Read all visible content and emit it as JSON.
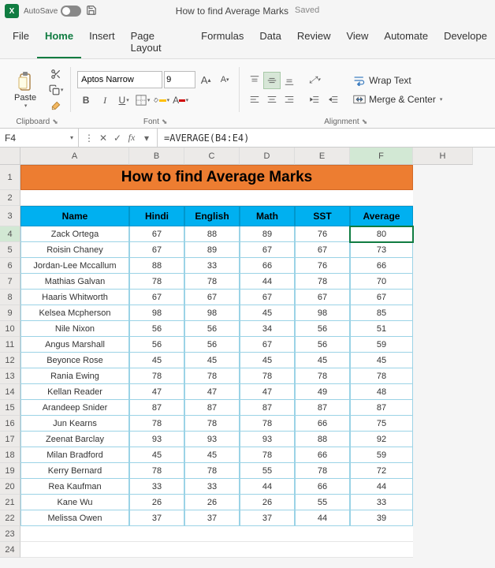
{
  "titlebar": {
    "autosave_label": "AutoSave",
    "doc_name": "How to find Average Marks",
    "saved_status": "Saved"
  },
  "menubar": {
    "tabs": [
      "File",
      "Home",
      "Insert",
      "Page Layout",
      "Formulas",
      "Data",
      "Review",
      "View",
      "Automate",
      "Develope"
    ]
  },
  "ribbon": {
    "clipboard": {
      "paste": "Paste",
      "group": "Clipboard"
    },
    "font": {
      "name": "Aptos Narrow",
      "size": "9",
      "group": "Font"
    },
    "alignment": {
      "wrap": "Wrap Text",
      "merge": "Merge & Center",
      "group": "Alignment"
    }
  },
  "formula": {
    "namebox": "F4",
    "bar": "=AVERAGE(B4:E4)"
  },
  "columns": [
    "A",
    "B",
    "C",
    "D",
    "E",
    "F",
    "H"
  ],
  "rows": [
    "1",
    "2",
    "3",
    "4",
    "5",
    "6",
    "7",
    "8",
    "9",
    "10",
    "11",
    "12",
    "13",
    "14",
    "15",
    "16",
    "17",
    "18",
    "19",
    "20",
    "21",
    "22",
    "23",
    "24"
  ],
  "sheet": {
    "title": "How to find Average Marks",
    "headers": [
      "Name",
      "Hindi",
      "English",
      "Math",
      "SST",
      "Average"
    ],
    "data": [
      {
        "name": "Zack Ortega",
        "hindi": "67",
        "english": "88",
        "math": "89",
        "sst": "76",
        "avg": "80"
      },
      {
        "name": "Roisin Chaney",
        "hindi": "67",
        "english": "89",
        "math": "67",
        "sst": "67",
        "avg": "73"
      },
      {
        "name": "Jordan-Lee Mccallum",
        "hindi": "88",
        "english": "33",
        "math": "66",
        "sst": "76",
        "avg": "66"
      },
      {
        "name": "Mathias Galvan",
        "hindi": "78",
        "english": "78",
        "math": "44",
        "sst": "78",
        "avg": "70"
      },
      {
        "name": "Haaris Whitworth",
        "hindi": "67",
        "english": "67",
        "math": "67",
        "sst": "67",
        "avg": "67"
      },
      {
        "name": "Kelsea Mcpherson",
        "hindi": "98",
        "english": "98",
        "math": "45",
        "sst": "98",
        "avg": "85"
      },
      {
        "name": "Nile Nixon",
        "hindi": "56",
        "english": "56",
        "math": "34",
        "sst": "56",
        "avg": "51"
      },
      {
        "name": "Angus Marshall",
        "hindi": "56",
        "english": "56",
        "math": "67",
        "sst": "56",
        "avg": "59"
      },
      {
        "name": "Beyonce Rose",
        "hindi": "45",
        "english": "45",
        "math": "45",
        "sst": "45",
        "avg": "45"
      },
      {
        "name": "Rania Ewing",
        "hindi": "78",
        "english": "78",
        "math": "78",
        "sst": "78",
        "avg": "78"
      },
      {
        "name": "Kellan Reader",
        "hindi": "47",
        "english": "47",
        "math": "47",
        "sst": "49",
        "avg": "48"
      },
      {
        "name": "Arandeep Snider",
        "hindi": "87",
        "english": "87",
        "math": "87",
        "sst": "87",
        "avg": "87"
      },
      {
        "name": "Jun Kearns",
        "hindi": "78",
        "english": "78",
        "math": "78",
        "sst": "66",
        "avg": "75"
      },
      {
        "name": "Zeenat Barclay",
        "hindi": "93",
        "english": "93",
        "math": "93",
        "sst": "88",
        "avg": "92"
      },
      {
        "name": "Milan Bradford",
        "hindi": "45",
        "english": "45",
        "math": "78",
        "sst": "66",
        "avg": "59"
      },
      {
        "name": "Kerry Bernard",
        "hindi": "78",
        "english": "78",
        "math": "55",
        "sst": "78",
        "avg": "72"
      },
      {
        "name": "Rea Kaufman",
        "hindi": "33",
        "english": "33",
        "math": "44",
        "sst": "66",
        "avg": "44"
      },
      {
        "name": "Kane Wu",
        "hindi": "26",
        "english": "26",
        "math": "26",
        "sst": "55",
        "avg": "33"
      },
      {
        "name": "Melissa Owen",
        "hindi": "37",
        "english": "37",
        "math": "37",
        "sst": "44",
        "avg": "39"
      }
    ]
  }
}
